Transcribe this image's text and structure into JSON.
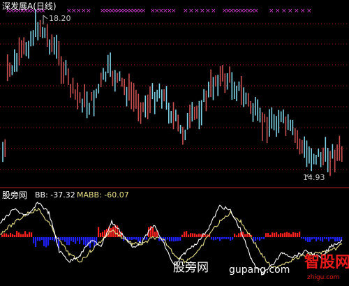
{
  "price_panel": {
    "title": "深发展A(日线)",
    "high_label": "18.20",
    "low_label": "14.93",
    "grid_color": "#a01e1e",
    "up_color": "#c85050",
    "down_color": "#7fd3e6",
    "signal_color": "#d040d0"
  },
  "indicator_panel": {
    "name": "股旁网",
    "bb_text": "BB: -37.32",
    "mabb_text": "MABB: -60.07",
    "bb_line_color": "#ffffff",
    "mabb_line_color": "#e8e08c",
    "pos_bar_color": "#ff2020",
    "neg_bar_color": "#2020ff"
  },
  "watermark": {
    "cn_text": "股旁网",
    "url_text": "gupang.com",
    "logo_text": "智股网",
    "logo_url": "zhigu.com"
  }
}
